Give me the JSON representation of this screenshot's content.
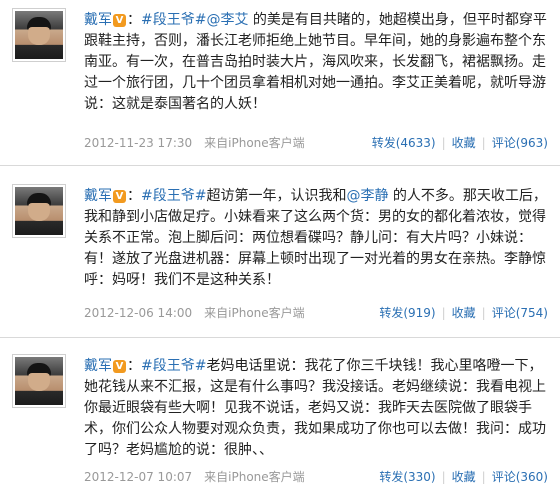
{
  "posts": [
    {
      "author": "戴军",
      "topic": "#段王爷#",
      "mention": "@李艾",
      "text_before": "",
      "text": " 的美是有目共睹的，她超模出身，但平时都穿平跟鞋主持，否则，潘长江老师拒绝上她节目。早年间，她的身影遍布整个东南亚。有一次，在普吉岛拍时装大片，海风吹来，长发翻飞，裙裾飘扬。走过一个旅行团，几十个团员拿着相机对她一通拍。李艾正美着呢，就听导游说：这就是泰国著名的人妖！",
      "time": "2012-11-23 17:30",
      "source": "来自iPhone客户端",
      "repost": "转发(4633)",
      "favorite": "收藏",
      "comment": "评论(963)"
    },
    {
      "author": "戴军",
      "topic": "#段王爷#",
      "text_before": "超访第一年，认识我和",
      "mention": "@李静",
      "text": " 的人不多。那天收工后，我和静到小店做足疗。小妹看来了这么两个货：男的女的都化着浓妆，觉得关系不正常。泡上脚后问：两位想看碟吗？静儿问：有大片吗？小妹说：有！遂放了光盘进机器：屏幕上顿时出现了一对光着的男女在亲热。李静惊呼：妈呀！我们不是这种关系！",
      "time": "2012-12-06 14:00",
      "source": "来自iPhone客户端",
      "repost": "转发(919)",
      "favorite": "收藏",
      "comment": "评论(754)"
    },
    {
      "author": "戴军",
      "topic": "#段王爷#",
      "text_before": "",
      "mention": "",
      "text": "老妈电话里说：我花了你三千块钱！我心里咯噔一下，她花钱从来不汇报，这是有什么事吗？我没接话。老妈继续说：我看电视上你最近眼袋有些大啊！见我不说话，老妈又说：我昨天去医院做了眼袋手术，你们公众人物要对观众负责，我如果成功了你也可以去做！我问：成功了吗？老妈尴尬的说：很肿、、",
      "time": "2012-12-07 10:07",
      "source": "来自iPhone客户端",
      "repost": "转发(330)",
      "favorite": "收藏",
      "comment": "评论(360)"
    }
  ],
  "badge": "V",
  "colors": {
    "link": "#2a6fb3",
    "meta": "#999999",
    "badge": "#f29a1f"
  }
}
